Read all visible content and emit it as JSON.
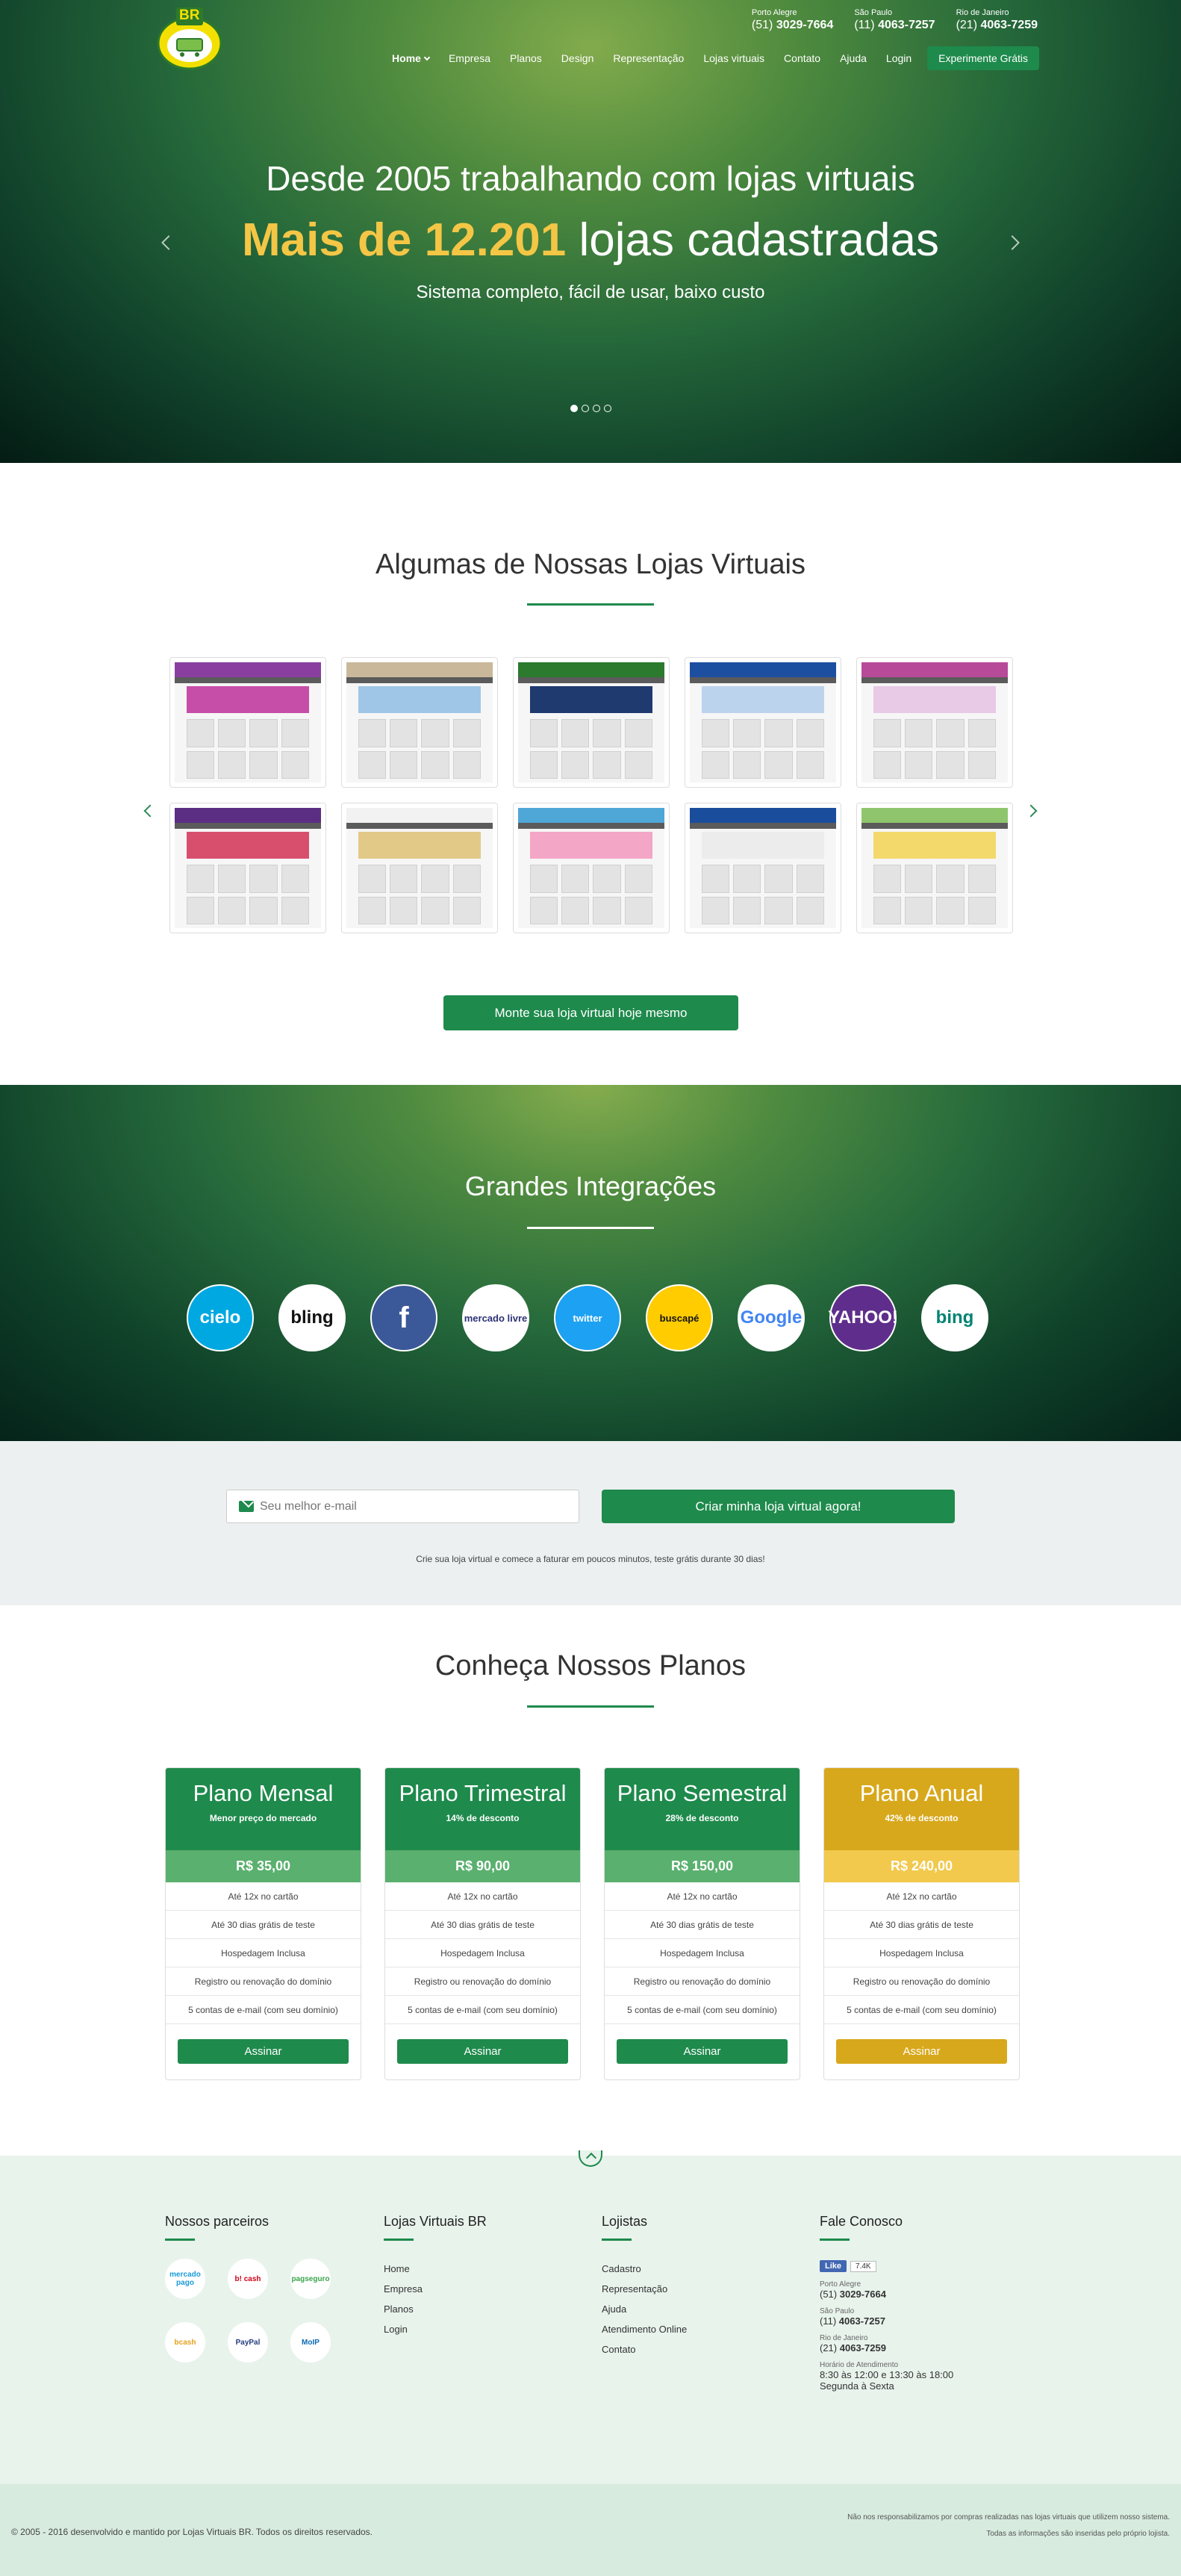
{
  "header": {
    "logo_text": "BR",
    "phones": [
      {
        "city": "Porto Alegre",
        "ddd": "(51)",
        "number": "3029-7664"
      },
      {
        "city": "São Paulo",
        "ddd": "(11)",
        "number": "4063-7257"
      },
      {
        "city": "Rio de Janeiro",
        "ddd": "(21)",
        "number": "4063-7259"
      }
    ],
    "nav": [
      "Home",
      "Empresa",
      "Planos",
      "Design",
      "Representação",
      "Lojas virtuais",
      "Contato",
      "Ajuda",
      "Login"
    ],
    "cta": "Experimente Grátis"
  },
  "hero": {
    "line1": "Desde 2005 trabalhando com lojas virtuais",
    "line2_highlight": "Mais de 12.201",
    "line2_rest": "lojas cadastradas",
    "line3": "Sistema completo, fácil de usar, baixo custo",
    "slides": 4,
    "active_slide": 1
  },
  "stores": {
    "title": "Algumas de Nossas Lojas Virtuais",
    "button": "Monte sua loja virtual hoje mesmo",
    "items": [
      {
        "name": "store-1",
        "accent": "#8a3fa0",
        "banner": "#c64ea8"
      },
      {
        "name": "store-2",
        "accent": "#c9b99a",
        "banner": "#9fc6e6"
      },
      {
        "name": "store-3",
        "accent": "#2b7a2e",
        "banner": "#1e3a6e"
      },
      {
        "name": "store-4",
        "accent": "#1d4fa0",
        "banner": "#bcd3ee"
      },
      {
        "name": "store-5",
        "accent": "#b84a9a",
        "banner": "#e8c9e6"
      },
      {
        "name": "store-6",
        "accent": "#5b2e83",
        "banner": "#d84f6d"
      },
      {
        "name": "store-7",
        "accent": "#f2f2f2",
        "banner": "#e3c987"
      },
      {
        "name": "store-8",
        "accent": "#4fa7d8",
        "banner": "#f4a6c6"
      },
      {
        "name": "store-9",
        "accent": "#1a4d9c",
        "banner": "#ececec"
      },
      {
        "name": "store-10",
        "accent": "#8fc66d",
        "banner": "#f3d96b"
      }
    ]
  },
  "integrations": {
    "title": "Grandes Integrações",
    "partners": [
      {
        "label": "cielo",
        "bg": "#00a8e1",
        "fg": "#ffffff"
      },
      {
        "label": "bling",
        "bg": "#ffffff",
        "fg": "#111111"
      },
      {
        "label": "f",
        "bg": "#3b5998",
        "fg": "#ffffff"
      },
      {
        "label": "mercado livre",
        "bg": "#ffffff",
        "fg": "#2d3277"
      },
      {
        "label": "twitter",
        "bg": "#1da1f2",
        "fg": "#ffffff"
      },
      {
        "label": "buscapé",
        "bg": "#ffcc00",
        "fg": "#111111"
      },
      {
        "label": "Google",
        "bg": "#ffffff",
        "fg": "#4285f4"
      },
      {
        "label": "YAHOO!",
        "bg": "#5f2e8c",
        "fg": "#ffffff"
      },
      {
        "label": "bing",
        "bg": "#ffffff",
        "fg": "#008373"
      }
    ]
  },
  "signup": {
    "placeholder": "Seu melhor e-mail",
    "button": "Criar minha loja virtual agora!",
    "note": "Crie sua loja virtual e comece a faturar em poucos minutos, teste grátis durante 30 dias!"
  },
  "plans": {
    "title": "Conheça Nossos Planos",
    "items": [
      {
        "name": "Plano Mensal",
        "sub_bold": "",
        "sub_rest": "Menor preço do mercado",
        "price": "R$ 35,00",
        "color": "#1e8a4c",
        "price_color": "#5ab06e"
      },
      {
        "name": "Plano Trimestral",
        "sub_bold": "14%",
        "sub_rest": " de desconto",
        "price": "R$ 90,00",
        "color": "#1e8a4c",
        "price_color": "#5ab06e"
      },
      {
        "name": "Plano Semestral",
        "sub_bold": "28%",
        "sub_rest": " de desconto",
        "price": "R$ 150,00",
        "color": "#1e8a4c",
        "price_color": "#5ab06e"
      },
      {
        "name": "Plano Anual",
        "sub_bold": "42%",
        "sub_rest": " de desconto",
        "price": "R$ 240,00",
        "color": "#d8a81c",
        "price_color": "#f2c94c"
      }
    ],
    "features": [
      "Até 12x no cartão",
      "Até 30 dias grátis de teste",
      "Hospedagem Inclusa",
      "Registro ou renovação do domínio",
      "5 contas de e-mail (com seu domínio)"
    ],
    "buy_label": "Assinar"
  },
  "footer": {
    "partners_title": "Nossos parceiros",
    "partner_logos": [
      "mercado pago",
      "b! cash",
      "pagseguro",
      "bcash",
      "PayPal",
      "MoIP"
    ],
    "links_title": "Lojas Virtuais BR",
    "links": [
      "Home",
      "Empresa",
      "Planos",
      "Login"
    ],
    "shop_title": "Lojistas",
    "shop_links": [
      "Cadastro",
      "Representação",
      "Ajuda",
      "Atendimento Online",
      "Contato"
    ],
    "contact_title": "Fale Conosco",
    "fb_like": "Like",
    "fb_count": "7.4K",
    "contacts": [
      {
        "city": "Porto Alegre",
        "ddd": "(51)",
        "number": "3029-7664"
      },
      {
        "city": "São Paulo",
        "ddd": "(11)",
        "number": "4063-7257"
      },
      {
        "city": "Rio de Janeiro",
        "ddd": "(21)",
        "number": "4063-7259"
      }
    ],
    "hours_label": "Horário de Atendimento",
    "hours": "8:30 às 12:00 e 13:30 às 18:00",
    "days": "Segunda à Sexta",
    "copyright": "© 2005 - 2016 desenvolvido e mantido por Lojas Virtuais BR. Todos os direitos reservados.",
    "disclaimer1": "Não nos responsabilizamos por compras realizadas nas lojas virtuais que utilizem nosso sistema.",
    "disclaimer2": "Todas as informações são inseridas pelo próprio lojista."
  }
}
